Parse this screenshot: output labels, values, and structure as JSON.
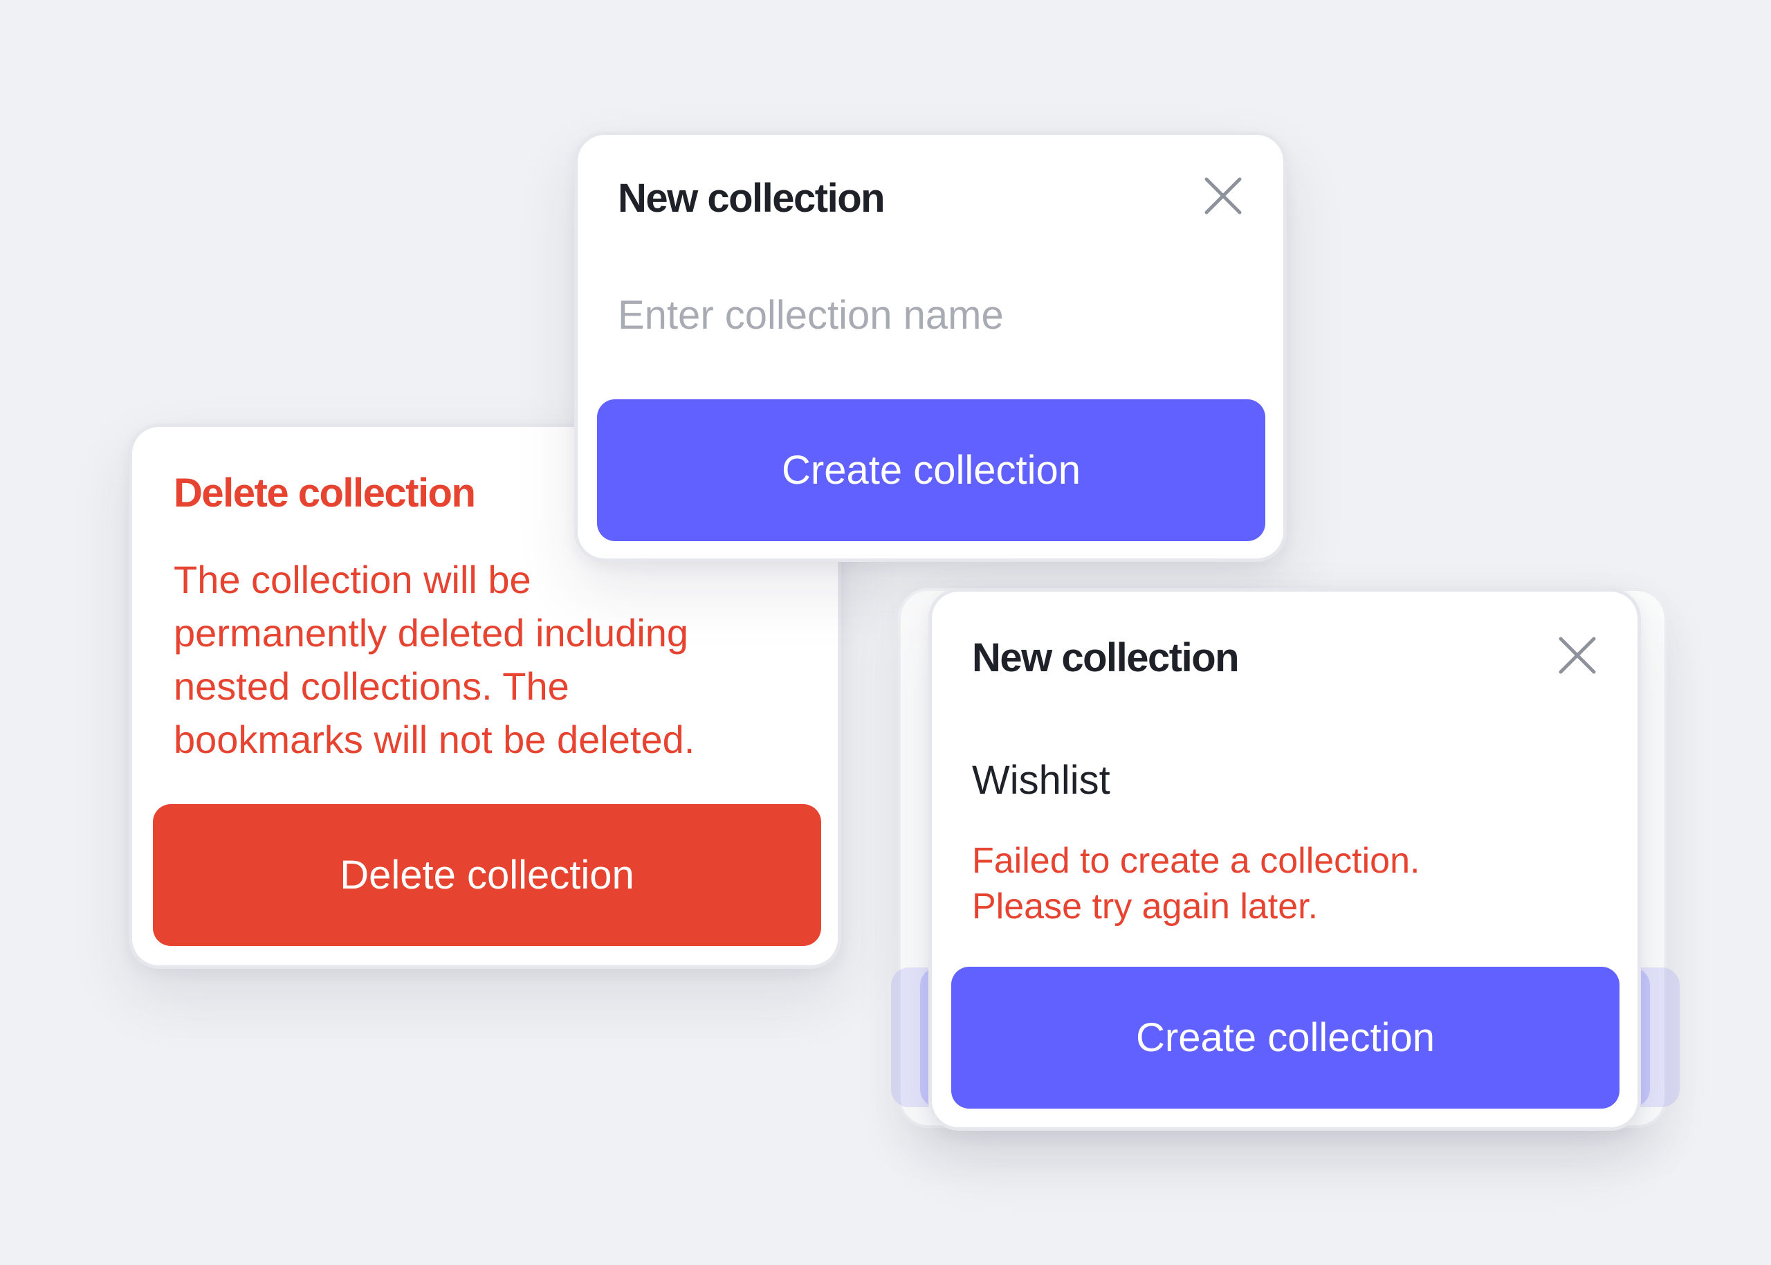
{
  "delete_modal": {
    "title": "Delete collection",
    "message_lines": [
      "The collection will be",
      "permanently deleted including",
      "nested collections. The",
      "bookmarks will not be deleted."
    ],
    "button_label": "Delete collection"
  },
  "new_collection_modal": {
    "title": "New collection",
    "input_placeholder": "Enter collection name",
    "button_label": "Create collection",
    "close_icon": "close-icon"
  },
  "error_modal": {
    "title": "New collection",
    "input_value": "Wishlist",
    "error_lines": [
      "Failed to create a collection.",
      "Please try again later."
    ],
    "button_label": "Create collection",
    "close_icon": "close-icon"
  },
  "colors": {
    "background": "#f0f1f4",
    "primary": "#6061fe",
    "danger": "#e64330",
    "text": "#1e2128",
    "placeholder": "#a8abb3"
  }
}
